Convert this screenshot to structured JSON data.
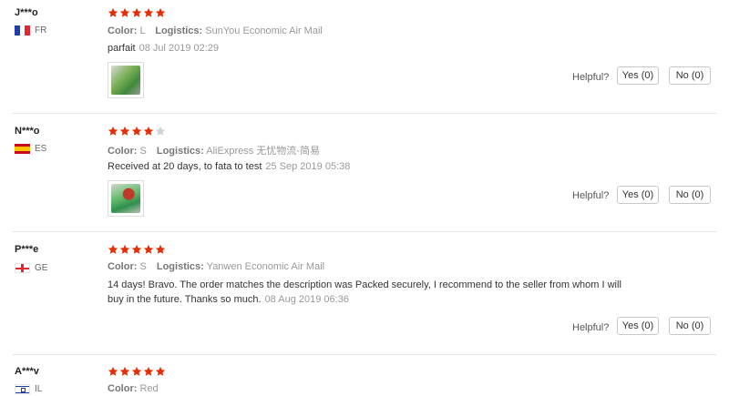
{
  "colors": {
    "star_filled": "#e62e04",
    "star_empty": "#d0d0d0"
  },
  "reviews": [
    {
      "user": "J***o",
      "country": "FR",
      "rating": 5,
      "color_label": "Color:",
      "color_value": "L",
      "logistics_label": "Logistics:",
      "logistics_value": "SunYou Economic Air Mail",
      "feedback": "parfait",
      "date": "08 Jul 2019 02:29",
      "has_photo": true,
      "helpful_label": "Helpful?",
      "yes_label": "Yes (0)",
      "no_label": "No (0)"
    },
    {
      "user": "N***o",
      "country": "ES",
      "rating": 4,
      "color_label": "Color:",
      "color_value": "S",
      "logistics_label": "Logistics:",
      "logistics_value": "AliExpress 无忧物流-简易",
      "feedback": "Received at 20 days, to fata to test",
      "date": "25 Sep 2019 05:38",
      "has_photo": true,
      "helpful_label": "Helpful?",
      "yes_label": "Yes (0)",
      "no_label": "No (0)"
    },
    {
      "user": "P***e",
      "country": "GE",
      "rating": 5,
      "color_label": "Color:",
      "color_value": "S",
      "logistics_label": "Logistics:",
      "logistics_value": "Yanwen Economic Air Mail",
      "feedback_line1": "14 days! Bravo. The order matches the description was Packed securely, I recommend to the seller from whom I will",
      "feedback_line2": "buy in the future. Thanks so much.",
      "date": "08 Aug 2019 06:36",
      "has_photo": false,
      "helpful_label": "Helpful?",
      "yes_label": "Yes (0)",
      "no_label": "No (0)"
    },
    {
      "user": "A***v",
      "country": "IL",
      "rating": 5,
      "color_label": "Color:",
      "color_value": "Red"
    }
  ]
}
